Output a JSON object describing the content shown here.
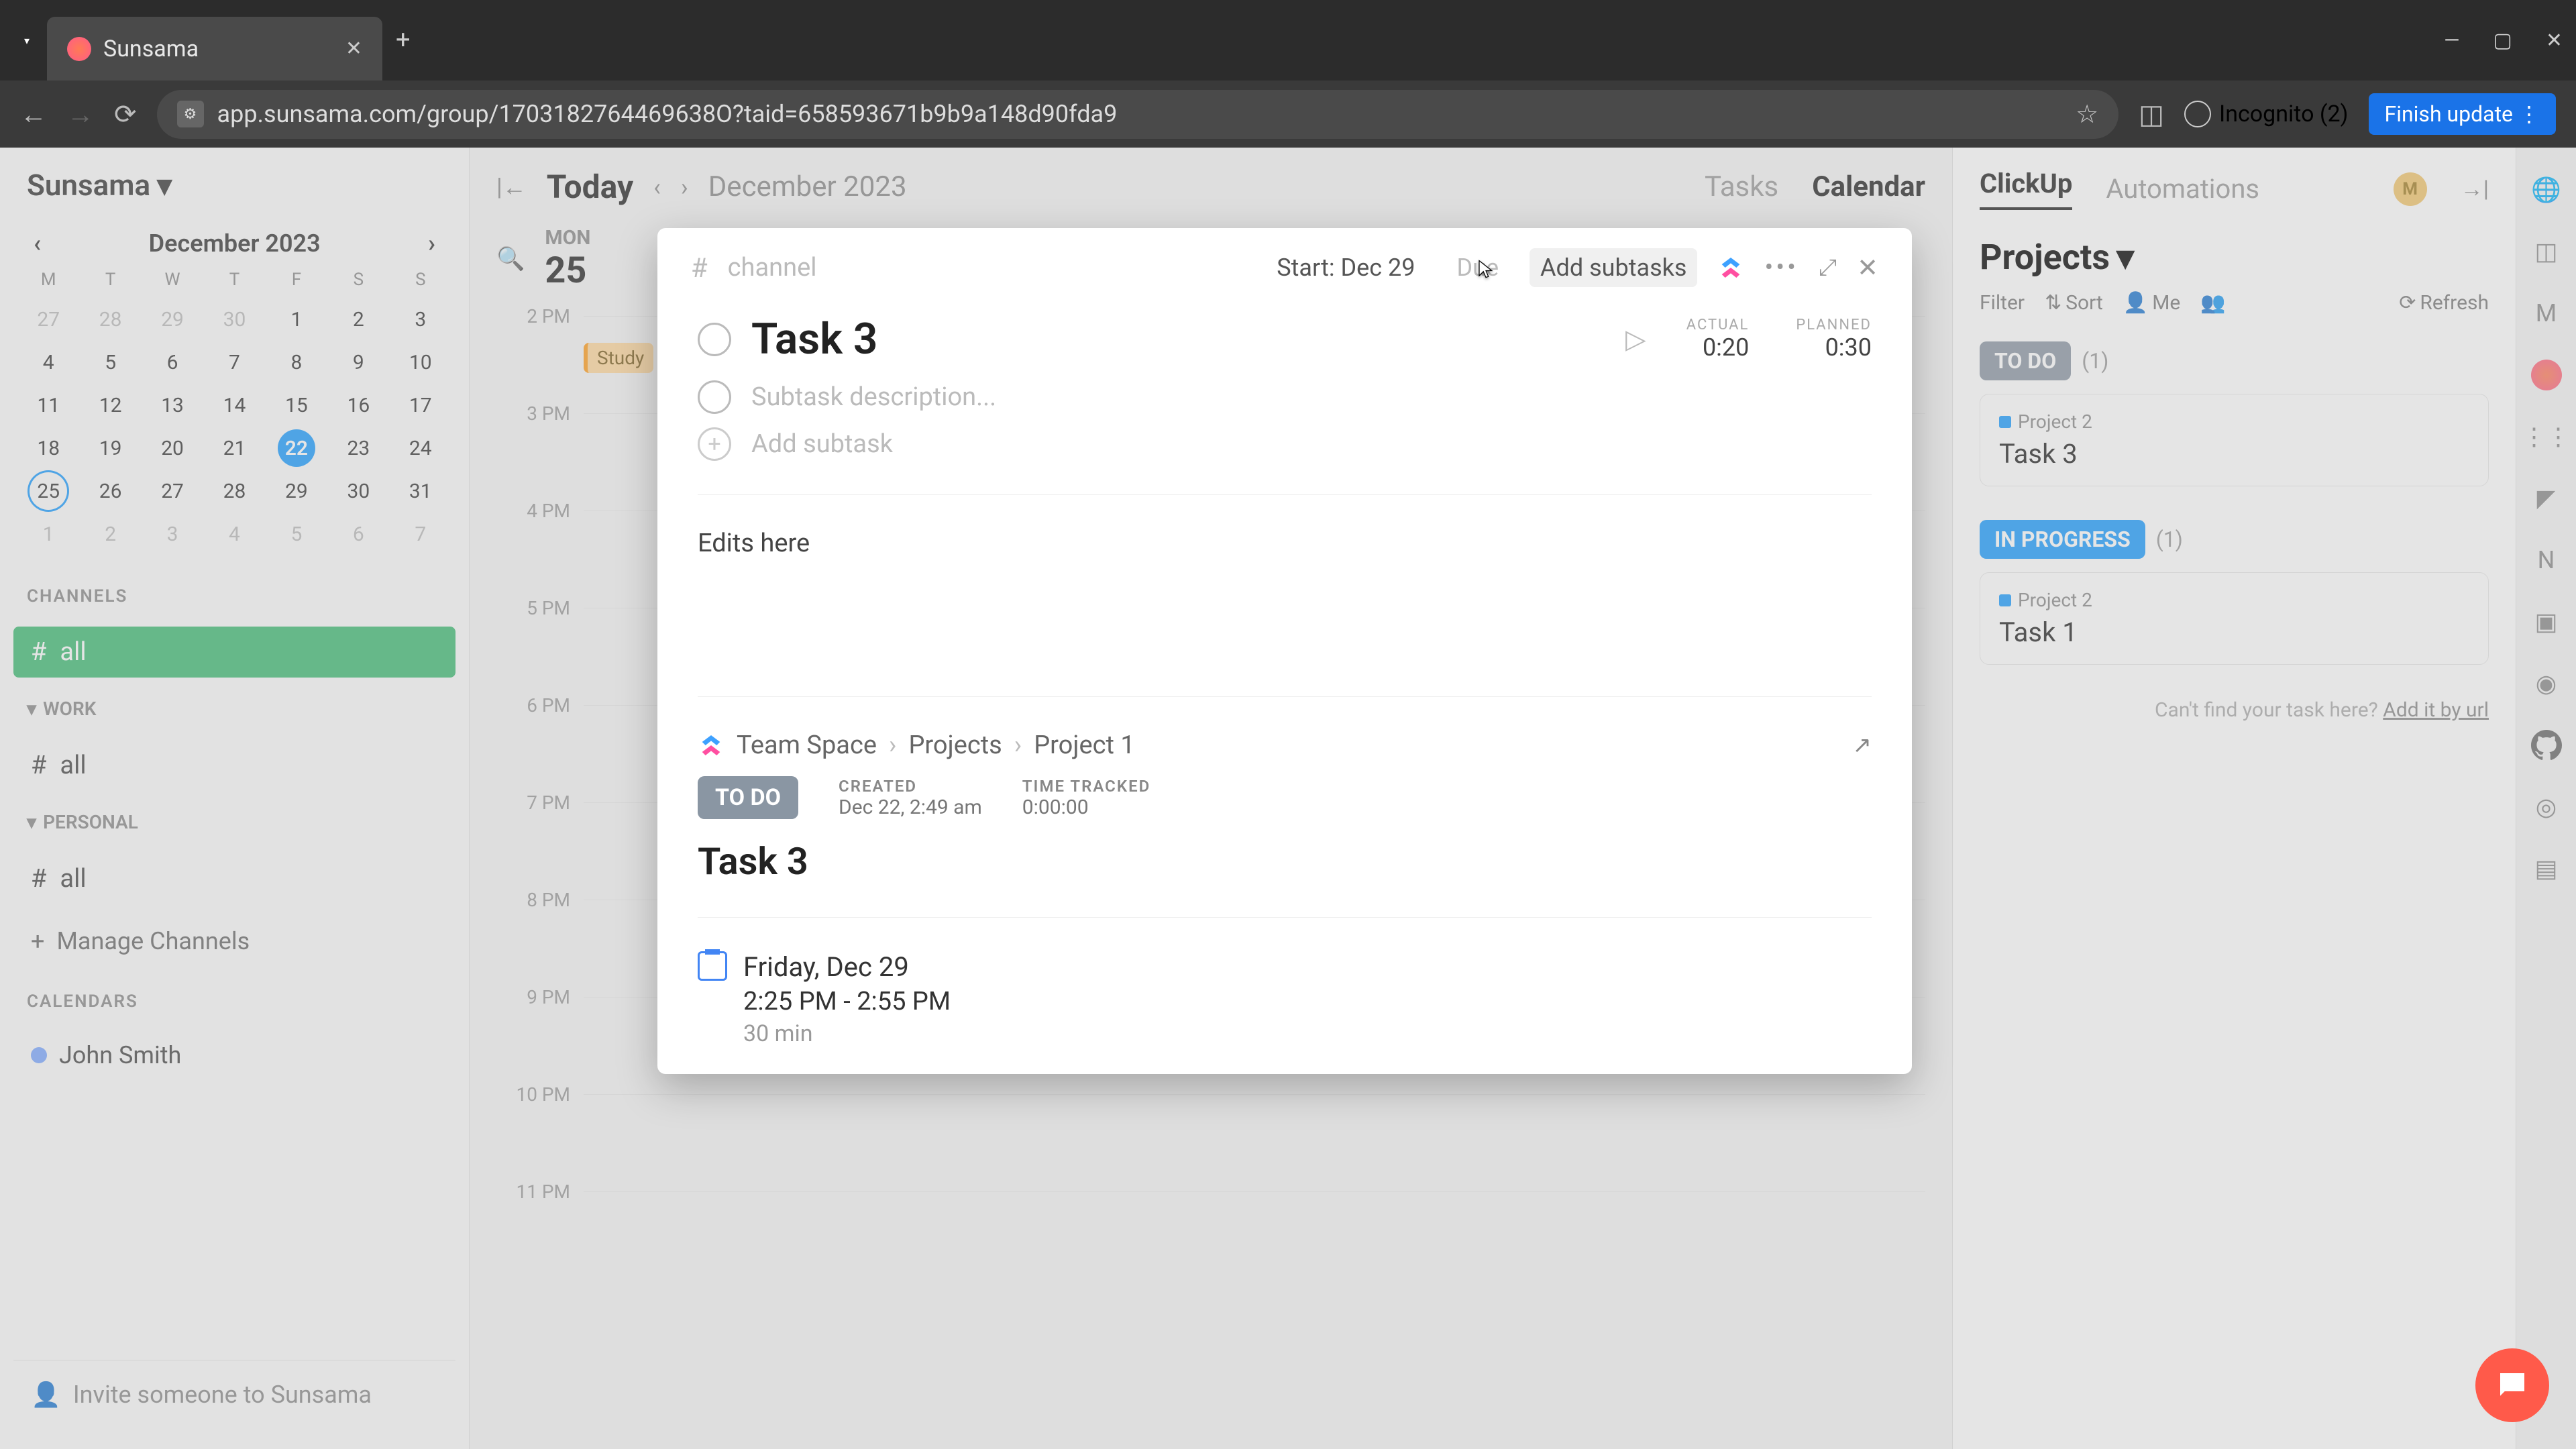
{
  "browser": {
    "tab_title": "Sunsama",
    "url": "app.sunsama.com/group/1703182764469638O?taid=658593671b9b9a148d90fda9",
    "incognito": "Incognito (2)",
    "finish": "Finish update"
  },
  "workspace": {
    "name": "Sunsama"
  },
  "minical": {
    "month": "December 2023",
    "dow": [
      "M",
      "T",
      "W",
      "T",
      "F",
      "S",
      "S"
    ],
    "rows": [
      [
        {
          "n": "27",
          "o": 1
        },
        {
          "n": "28",
          "o": 1
        },
        {
          "n": "29",
          "o": 1
        },
        {
          "n": "30",
          "o": 1
        },
        {
          "n": "1"
        },
        {
          "n": "2"
        },
        {
          "n": "3"
        }
      ],
      [
        {
          "n": "4"
        },
        {
          "n": "5"
        },
        {
          "n": "6"
        },
        {
          "n": "7"
        },
        {
          "n": "8"
        },
        {
          "n": "9"
        },
        {
          "n": "10"
        }
      ],
      [
        {
          "n": "11"
        },
        {
          "n": "12"
        },
        {
          "n": "13"
        },
        {
          "n": "14"
        },
        {
          "n": "15"
        },
        {
          "n": "16"
        },
        {
          "n": "17"
        }
      ],
      [
        {
          "n": "18"
        },
        {
          "n": "19"
        },
        {
          "n": "20"
        },
        {
          "n": "21"
        },
        {
          "n": "22",
          "sel": 1
        },
        {
          "n": "23"
        },
        {
          "n": "24"
        }
      ],
      [
        {
          "n": "25",
          "ring": 1
        },
        {
          "n": "26"
        },
        {
          "n": "27"
        },
        {
          "n": "28"
        },
        {
          "n": "29"
        },
        {
          "n": "30"
        },
        {
          "n": "31"
        }
      ],
      [
        {
          "n": "1",
          "o": 1
        },
        {
          "n": "2",
          "o": 1
        },
        {
          "n": "3",
          "o": 1
        },
        {
          "n": "4",
          "o": 1
        },
        {
          "n": "5",
          "o": 1
        },
        {
          "n": "6",
          "o": 1
        },
        {
          "n": "7",
          "o": 1
        }
      ]
    ]
  },
  "sidebar": {
    "channels_label": "CHANNELS",
    "all": "all",
    "work_label": "WORK",
    "personal_label": "PERSONAL",
    "manage": "Manage Channels",
    "calendars_label": "CALENDARS",
    "calendar_user": "John Smith",
    "invite": "Invite someone to Sunsama"
  },
  "center": {
    "today": "Today",
    "month": "December 2023",
    "tabs": {
      "tasks": "Tasks",
      "calendar": "Calendar"
    },
    "dow": "MON",
    "daynum": "25",
    "hours": [
      "2 PM",
      "3 PM",
      "4 PM",
      "5 PM",
      "6 PM",
      "7 PM",
      "8 PM",
      "9 PM",
      "10 PM",
      "11 PM"
    ],
    "event": "Study"
  },
  "right": {
    "tabs": {
      "clickup": "ClickUp",
      "automations": "Automations"
    },
    "avatar": "M",
    "projects": "Projects",
    "filter": "Filter",
    "sort": "Sort",
    "me": "Me",
    "refresh": "Refresh",
    "todo": "TO DO",
    "todo_count": "(1)",
    "card1": {
      "project": "Project 2",
      "task": "Task 3"
    },
    "inprogress": "IN PROGRESS",
    "ip_count": "(1)",
    "card2": {
      "project": "Project 2",
      "task": "Task 1"
    },
    "hint_pre": "Can't find your task here? ",
    "hint_link": "Add it by url"
  },
  "modal": {
    "channel_ph": "channel",
    "start": "Start: Dec 29",
    "due": "Due",
    "add_subtasks": "Add subtasks",
    "title": "Task 3",
    "actual_lbl": "ACTUAL",
    "actual_val": "0:20",
    "planned_lbl": "PLANNED",
    "planned_val": "0:30",
    "subtask_ph": "Subtask description...",
    "add_subtask_ph": "Add subtask",
    "notes": "Edits here",
    "breadcrumb": [
      "Team Space",
      "Projects",
      "Project 1"
    ],
    "todo": "TO DO",
    "created_lbl": "CREATED",
    "created_val": "Dec 22, 2:49 am",
    "tracked_lbl": "TIME TRACKED",
    "tracked_val": "0:00:00",
    "linked_title": "Task 3",
    "cal_date": "Friday, Dec 29",
    "cal_time": "2:25 PM - 2:55 PM",
    "cal_dur": "30 min"
  }
}
